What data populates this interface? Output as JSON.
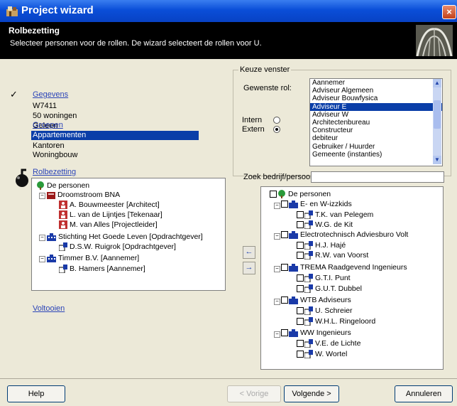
{
  "window": {
    "title": "Project wizard",
    "close": "×"
  },
  "header": {
    "title": "Rolbezetting",
    "subtitle": "Selecteer personen voor de rollen. De wizard selecteert de rollen voor U."
  },
  "nav": {
    "check": "✓",
    "gegevens": "Gegevens",
    "project_code": "W7411",
    "project_name": "50 woningen",
    "project_place": "Geleen",
    "groepen": "Groepen",
    "groups": [
      "Appartementen",
      "Kantoren",
      "Woningbouw"
    ],
    "rolbezetting": "Rolbezetting",
    "voltooien": "Voltooien"
  },
  "left_tree": {
    "root": "De personen",
    "org1": "Droomstroom BNA",
    "p1": "A. Bouwmeester [Architect]",
    "p2": "L. van de Lijntjes [Tekenaar]",
    "p3": "M. van Alles [Projectleider]",
    "org2": "Stichting Het Goede Leven [Opdrachtgever]",
    "p4": "D.S.W. Ruigrok [Opdrachtgever]",
    "org3": "Timmer B.V. [Aannemer]",
    "p5": "B. Hamers [Aannemer]"
  },
  "keuze": {
    "group_label": "Keuze venster",
    "role_label": "Gewenste rol:",
    "roles": [
      "Aannemer",
      "Adviseur Algemeen",
      "Adviseur Bouwfysica",
      "Adviseur E",
      "Adviseur W",
      "Architectenbureau",
      "Constructeur",
      "debiteur",
      "Gebruiker / Huurder",
      "Gemeente (instanties)"
    ],
    "selected_role": "Adviseur E",
    "intern": "Intern",
    "extern": "Extern",
    "search_label": "Zoek bedrijf/persoon:"
  },
  "right_tree": {
    "root": "De personen",
    "o1": "E- en W-izzkids",
    "o1p1": "T.K. van Pelegem",
    "o1p2": "W.G. de Kit",
    "o2": "Electrotechnisch Adviesburo Volt",
    "o2p1": "H.J. Hajé",
    "o2p2": "R.W. van Voorst",
    "o3": "TREMA Raadgevend Ingenieurs",
    "o3p1": "G.T.I. Punt",
    "o3p2": "G.U.T. Dubbel",
    "o4": "WTB Adviseurs",
    "o4p1": "U. Schreier",
    "o4p2": "W.H.L. Ringeloord",
    "o5": "WW Ingenieurs",
    "o5p1": "V.E. de Lichte",
    "o5p2": "W. Wortel"
  },
  "buttons": {
    "help": "Help",
    "back": "< Vorige",
    "next": "Volgende >",
    "cancel": "Annuleren",
    "move_left": "←",
    "move_right": "→"
  }
}
